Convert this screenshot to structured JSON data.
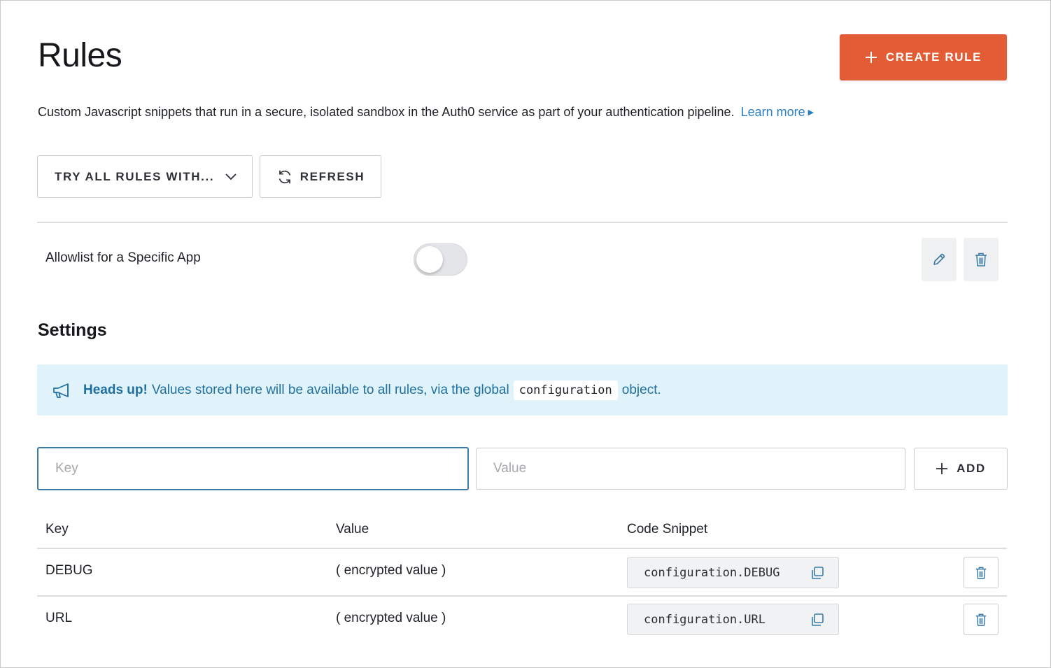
{
  "header": {
    "title": "Rules",
    "create_button": "CREATE RULE",
    "description": "Custom Javascript snippets that run in a secure, isolated sandbox in the Auth0 service as part of your authentication pipeline.",
    "learn_more": "Learn more"
  },
  "toolbar": {
    "try_all": "TRY ALL RULES WITH...",
    "refresh": "REFRESH"
  },
  "rules": [
    {
      "name": "Allowlist for a Specific App",
      "enabled": false
    }
  ],
  "settings": {
    "title": "Settings",
    "callout": {
      "strong": "Heads up!",
      "text_before": "Values stored here will be available to all rules, via the global",
      "code": "configuration",
      "text_after": "object."
    },
    "form": {
      "key_placeholder": "Key",
      "value_placeholder": "Value",
      "add_button": "ADD"
    },
    "table": {
      "columns": [
        "Key",
        "Value",
        "Code Snippet"
      ],
      "rows": [
        {
          "key": "DEBUG",
          "value": "( encrypted value )",
          "snippet": "configuration.DEBUG"
        },
        {
          "key": "URL",
          "value": "( encrypted value )",
          "snippet": "configuration.URL"
        }
      ]
    }
  },
  "colors": {
    "primary_button": "#e25d35",
    "link": "#2a7fbf",
    "callout_bg": "#e1f3fa",
    "callout_text": "#1f6f9f",
    "focus_border": "#3a7ba8"
  },
  "icons": {
    "create": "plus-icon",
    "try_all": "chevron-down-icon",
    "refresh": "refresh-icon",
    "edit": "pencil-icon",
    "delete": "trash-icon",
    "callout": "megaphone-icon",
    "add": "plus-icon",
    "copy": "copy-icon"
  }
}
